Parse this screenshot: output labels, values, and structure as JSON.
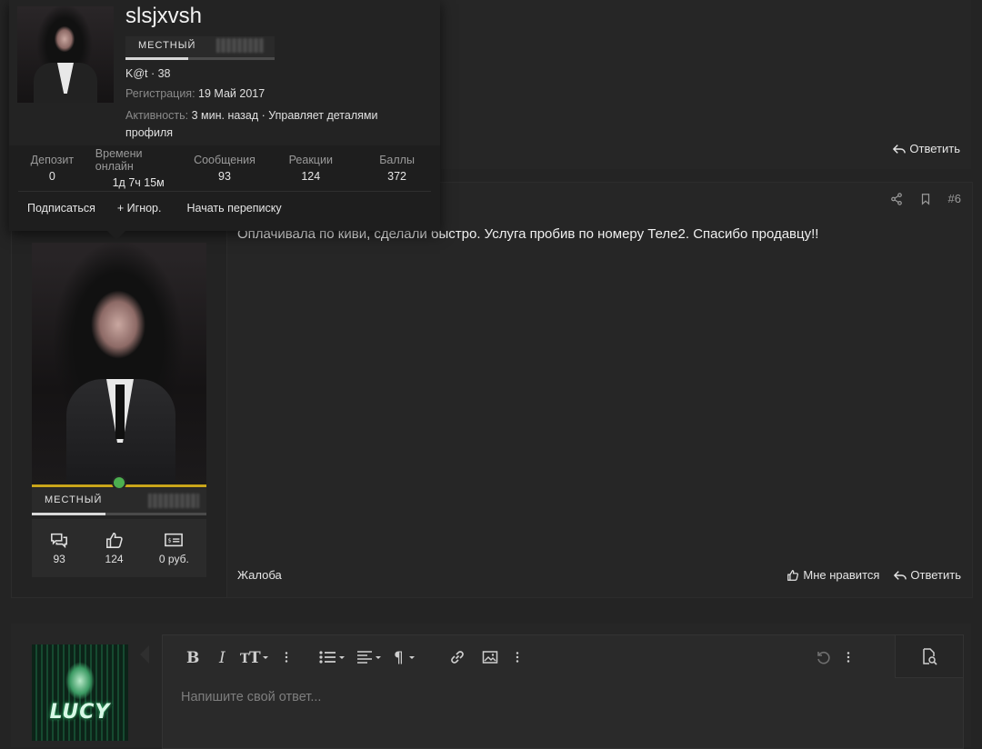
{
  "hover_card": {
    "username": "slsjxvsh",
    "rank": "МЕСТНЫЙ",
    "rank_progress": 0.42,
    "meta": "K@t · 38",
    "reg_label": "Регистрация:",
    "reg_value": "19 Май 2017",
    "activity_label": "Активность:",
    "activity_value_line1": "3 мин. назад · Управляет деталями",
    "activity_value_line2": "профиля",
    "stats": [
      {
        "label": "Депозит",
        "value": "0"
      },
      {
        "label": "Времени онлайн",
        "value": "1д 7ч 15м"
      },
      {
        "label": "Сообщения",
        "value": "93"
      },
      {
        "label": "Реакции",
        "value": "124"
      },
      {
        "label": "Баллы",
        "value": "372"
      }
    ],
    "actions": {
      "follow": "Подписаться",
      "ignore": "+ Игнор.",
      "message": "Начать переписку"
    }
  },
  "prev_post": {
    "reply_label": "Ответить"
  },
  "post": {
    "number": "#6",
    "text": "Оплачивала по киви, сделали быстро. Услуга пробив по номеру Теле2. Спасибо продавцу!!",
    "report_label": "Жалоба",
    "like_label": "Мне нравится",
    "reply_label": "Ответить",
    "user": {
      "rank": "МЕСТНЫЙ",
      "rank_progress": 0.42,
      "messages": "93",
      "reactions": "124",
      "balance": "0 руб."
    }
  },
  "reply_editor": {
    "avatar_text": "LUCY",
    "placeholder": "Напишите свой ответ..."
  },
  "colors": {
    "accent_gold": "#c9a51a",
    "online": "#4caf50",
    "background": "#242424"
  },
  "icons": [
    "reply-icon",
    "share-icon",
    "bookmark-icon",
    "like-icon",
    "messages-icon",
    "thumbs-up-icon",
    "money-icon",
    "bold-icon",
    "italic-icon",
    "text-size-icon",
    "more-icon",
    "list-icon",
    "align-icon",
    "paragraph-icon",
    "link-icon",
    "image-icon",
    "undo-icon",
    "preview-icon"
  ]
}
